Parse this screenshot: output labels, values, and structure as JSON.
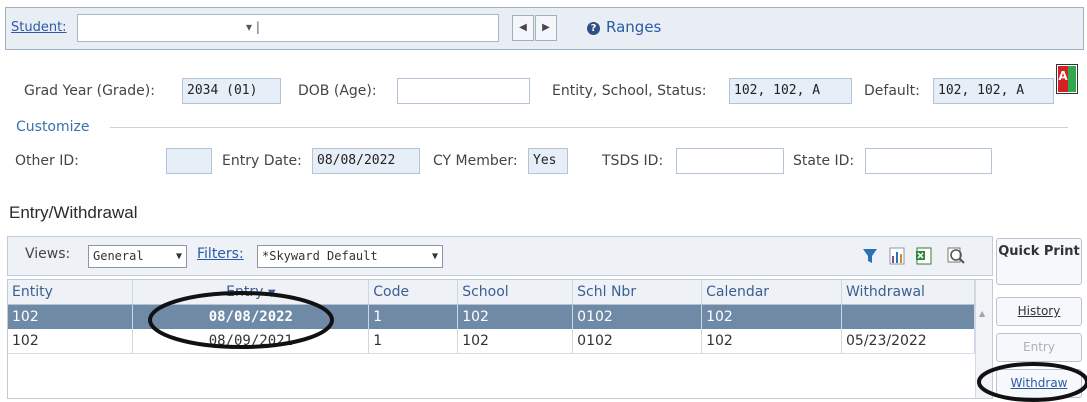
{
  "top": {
    "student_label": "Student:",
    "student_value": "",
    "ranges_label": "Ranges"
  },
  "info": {
    "grad_year_label": "Grad Year (Grade):",
    "grad_year_value": "2034 (01)",
    "dob_label": "DOB (Age):",
    "dob_value": "",
    "entity_label": "Entity, School, Status:",
    "entity_value": "102, 102, A",
    "default_label": "Default:",
    "default_value": "102, 102, A",
    "customize_label": "Customize",
    "other_id_label": "Other ID:",
    "other_id_value": "",
    "entry_date_label": "Entry Date:",
    "entry_date_value": "08/08/2022",
    "cy_member_label": "CY Member:",
    "cy_member_value": "Yes",
    "tsds_label": "TSDS ID:",
    "tsds_value": "",
    "state_id_label": "State ID:",
    "state_id_value": ""
  },
  "section": {
    "title": "Entry/Withdrawal",
    "views_label": "Views:",
    "views_value": "General",
    "filters_label": "Filters:",
    "filters_value": "*Skyward Default"
  },
  "table": {
    "columns": [
      "Entity",
      "Entry",
      "Code",
      "School",
      "Schl Nbr",
      "Calendar",
      "Withdrawal"
    ],
    "rows": [
      [
        "102",
        "08/08/2022",
        "1",
        "102",
        "0102",
        "102",
        ""
      ],
      [
        "102",
        "08/09/2021",
        "1",
        "102",
        "0102",
        "102",
        "05/23/2022"
      ]
    ]
  },
  "side_buttons": {
    "quick_print": "Quick Print",
    "history": "History",
    "entry": "Entry",
    "withdraw": "Withdraw"
  },
  "colors": {
    "selected_row": "#6f8aa6",
    "link": "#2a5aa8",
    "annotation": "#111111"
  }
}
